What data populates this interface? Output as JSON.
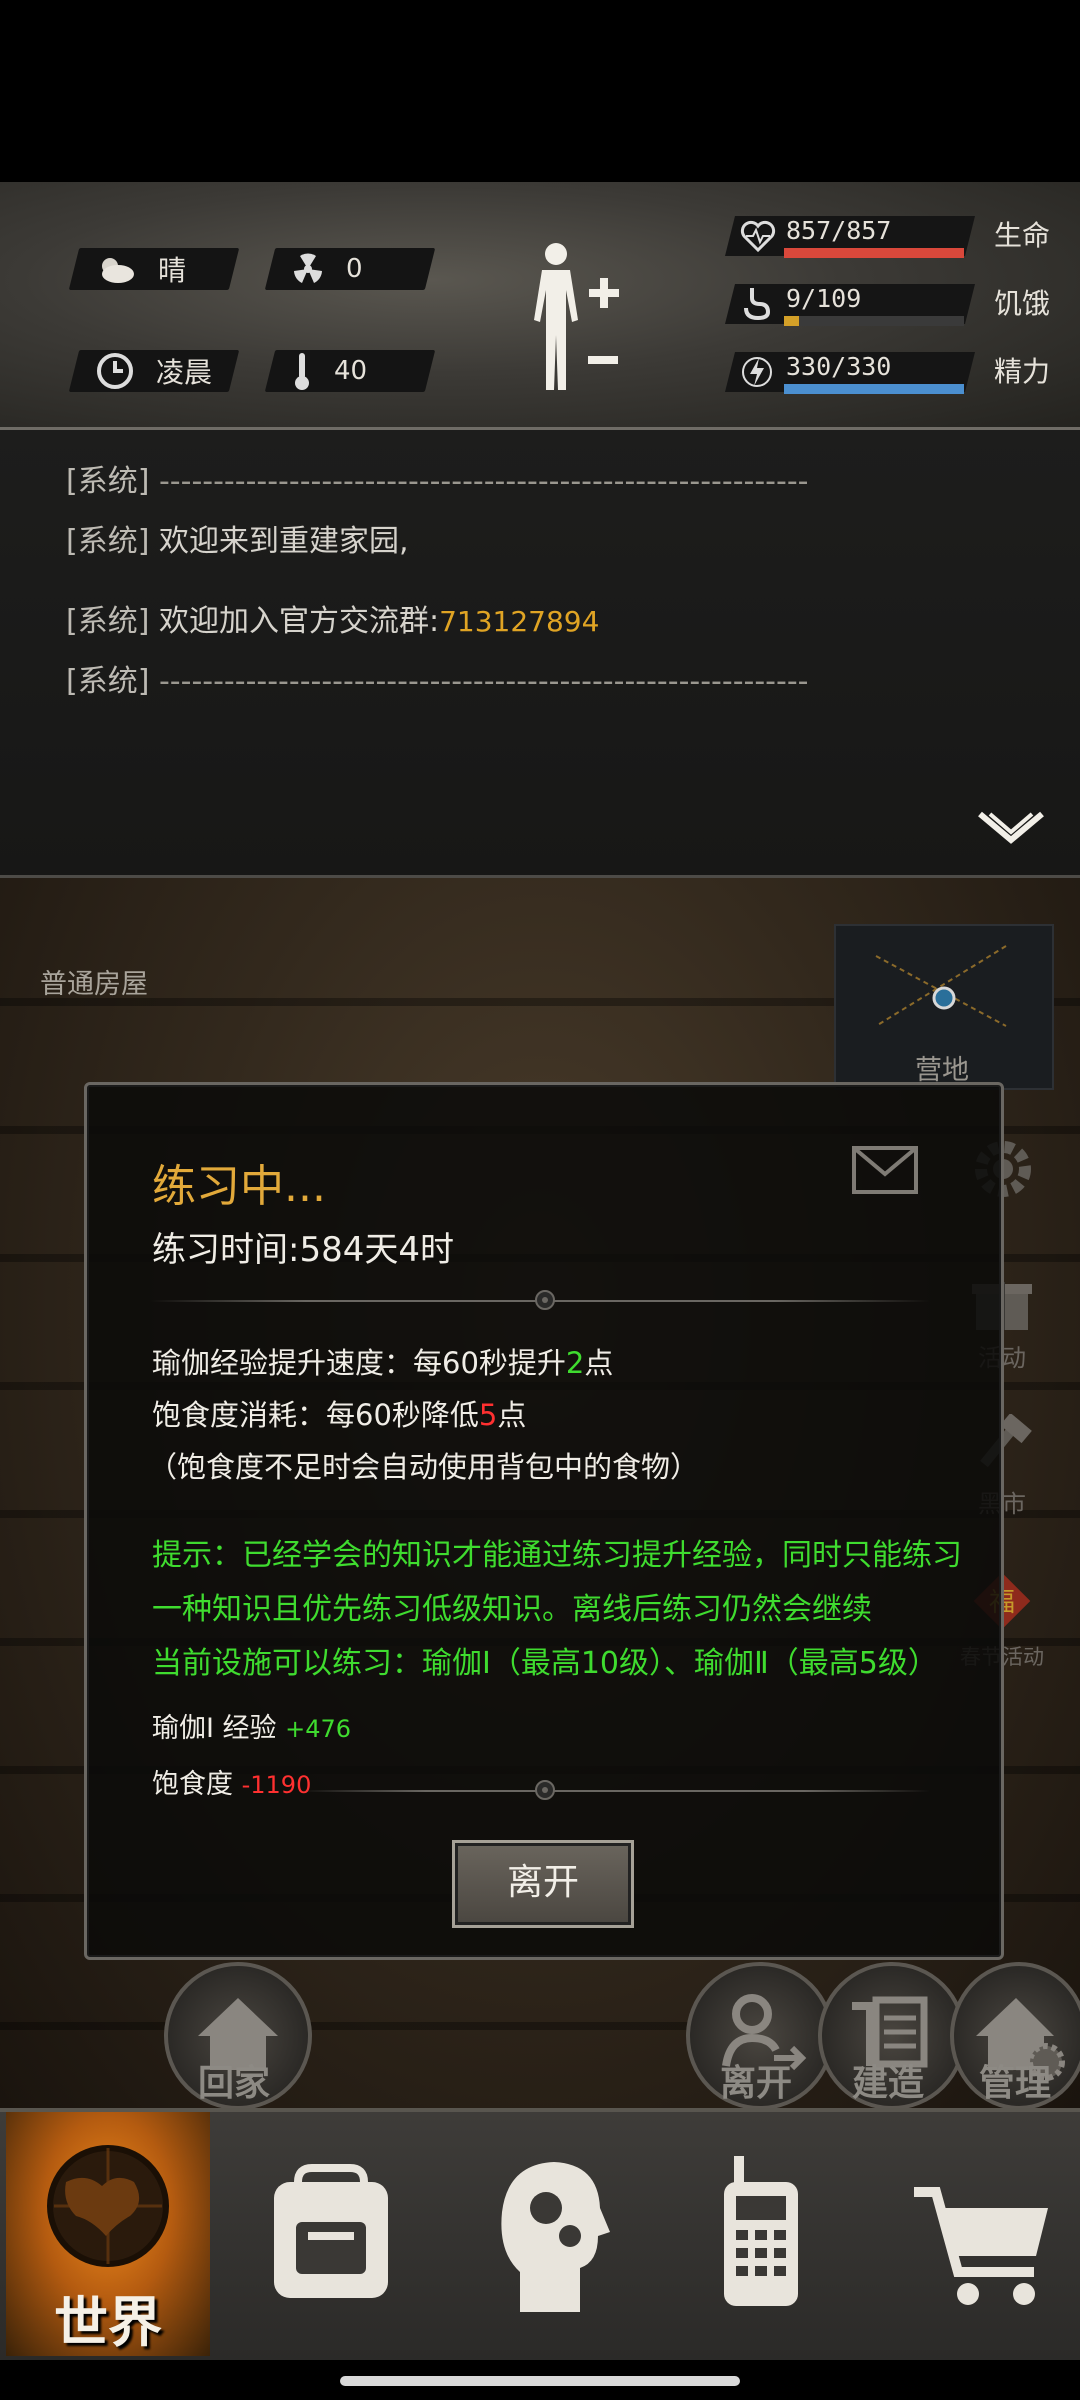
{
  "status": {
    "weather": "晴",
    "radiation": "0",
    "time_of_day": "凌晨",
    "temperature": "40",
    "health": {
      "text": "857/857",
      "label": "生命",
      "fraction": 1.0,
      "color": "#d9483b"
    },
    "hunger": {
      "text": "9/109",
      "label": "饥饿",
      "fraction": 0.083,
      "color": "#d4a028"
    },
    "energy": {
      "text": "330/330",
      "label": "精力",
      "fraction": 1.0,
      "color": "#4b8fd0"
    }
  },
  "log": {
    "lines": [
      {
        "tag": "[系统]",
        "text": "------------------------------------------------------------",
        "highlight": ""
      },
      {
        "tag": "[系统]",
        "text": "欢迎来到重建家园,",
        "highlight": ""
      },
      {
        "tag": "[系统]",
        "text": " 欢迎加入官方交流群:",
        "highlight": "713127894"
      },
      {
        "tag": "[系统]",
        "text": "------------------------------------------------------------",
        "highlight": ""
      }
    ]
  },
  "scene": {
    "location": "普通房屋",
    "minimap_label": "营地",
    "side_buttons": [
      "活动",
      "黑市",
      "春节活动"
    ],
    "round_buttons": [
      "回家",
      "离开",
      "建造",
      "管理"
    ]
  },
  "dialog": {
    "title": "练习中...",
    "time": "练习时间:584天4时",
    "line1_prefix": "瑜伽经验提升速度：每60秒提升",
    "line1_num": "2",
    "line1_suffix": "点",
    "line2_prefix": "饱食度消耗：每60秒降低",
    "line2_num": "5",
    "line2_suffix": "点",
    "line3": "（饱食度不足时会自动使用背包中的食物）",
    "tip1": "提示：已经学会的知识才能通过练习提升经验，同时只能练习",
    "tip2": "一种知识且优先练习低级知识。离线后练习仍然会继续",
    "tip3": "当前设施可以练习：瑜伽Ⅰ（最高10级）、瑜伽Ⅱ（最高5级）",
    "exp_label": "瑜伽Ⅰ 经验",
    "exp_value": "+476",
    "food_label": "饱食度",
    "food_value": "-1190",
    "leave_button": "离开"
  },
  "nav": {
    "world_label": "世界"
  }
}
